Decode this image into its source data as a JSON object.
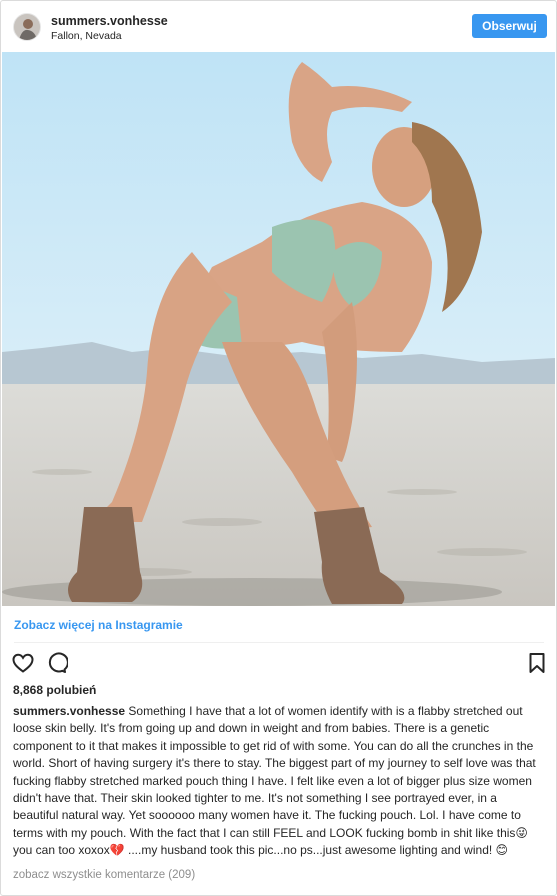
{
  "header": {
    "username": "summers.vonhesse",
    "location": "Fallon, Nevada",
    "follow_label": "Obserwuj"
  },
  "post": {
    "image_alt": "photo-icon",
    "view_more_label": "Zobacz więcej na Instagramie",
    "likes_text": "8,868 polubień",
    "caption_user": "summers.vonhesse",
    "caption_text": " Something I have that a lot of women identify with is a flabby stretched out loose skin belly. It's from going up and down in weight and from babies. There is a genetic component to it that makes it impossible to get rid of with some. You can do all the crunches in the world. Short of having surgery it's there to stay. The biggest part of my journey to self love was that fucking flabby stretched marked pouch thing I have. I felt like even a lot of bigger plus size women didn't have that. Their skin looked tighter to me. It's not something I see portrayed ever, in a beautiful natural way. Yet soooooo many women have it. The fucking pouch. Lol. I have come to terms with my pouch. With the fact that I can still FEEL and LOOK fucking bomb in shit like this😜you can too xoxox💔 ....my husband took this pic...no ps...just awesome lighting and wind! 😊",
    "comments_link": "zobacz wszystkie komentarze (209)"
  },
  "icons": {
    "like": "heart-icon",
    "comment": "comment-icon",
    "save": "bookmark-icon"
  },
  "colors": {
    "accent": "#3897f0",
    "text": "#262626",
    "muted": "#8e8e8e",
    "border": "#dbdbdb"
  }
}
